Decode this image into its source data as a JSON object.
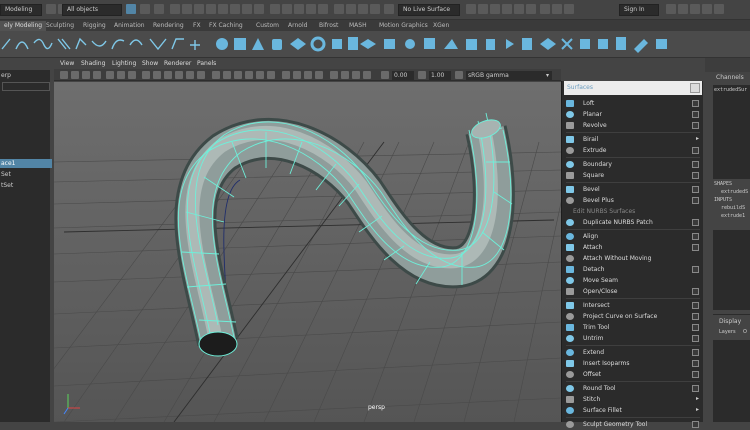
{
  "status_line": {
    "menu_set": "Modeling",
    "selection_mask": "All objects",
    "live_surface": "No Live Surface",
    "sign_in": "Sign In"
  },
  "shelf_tabs": [
    "ely Modeling",
    "Sculpting",
    "Rigging",
    "Animation",
    "Rendering",
    "FX",
    "FX Caching",
    "Custom",
    "Arnold",
    "Bifrost",
    "MASH",
    "Motion Graphics",
    "XGen"
  ],
  "outliner": {
    "items": [
      "erp",
      "ace1",
      "Set",
      "tSet"
    ]
  },
  "viewport": {
    "menus": [
      "View",
      "Shading",
      "Lighting",
      "Show",
      "Renderer",
      "Panels"
    ],
    "exposure": "0.00",
    "gamma": "1.00",
    "color_space": "sRGB gamma",
    "camera": "persp"
  },
  "surfaces_menu": {
    "title": "Surfaces",
    "items": [
      {
        "label": "Loft",
        "box": true
      },
      {
        "label": "Planar",
        "box": true
      },
      {
        "label": "Revolve",
        "box": true
      },
      {
        "sep": true
      },
      {
        "label": "Birail",
        "arrow": true
      },
      {
        "label": "Extrude",
        "box": true
      },
      {
        "sep": true
      },
      {
        "label": "Boundary",
        "box": true
      },
      {
        "label": "Square",
        "box": true
      },
      {
        "sep": true
      },
      {
        "label": "Bevel",
        "box": true
      },
      {
        "label": "Bevel Plus",
        "box": true
      },
      {
        "label": "Edit NURBS Surfaces",
        "section": true
      },
      {
        "label": "Duplicate NURBS Patch",
        "box": true
      },
      {
        "sep": true
      },
      {
        "label": "Align",
        "box": true
      },
      {
        "label": "Attach",
        "box": true
      },
      {
        "label": "Attach Without Moving"
      },
      {
        "label": "Detach",
        "box": true
      },
      {
        "label": "Move Seam"
      },
      {
        "label": "Open/Close",
        "box": true
      },
      {
        "sep": true
      },
      {
        "label": "Intersect",
        "box": true
      },
      {
        "label": "Project Curve on Surface",
        "box": true
      },
      {
        "label": "Trim Tool",
        "box": true
      },
      {
        "label": "Untrim",
        "box": true
      },
      {
        "sep": true
      },
      {
        "label": "Extend",
        "box": true
      },
      {
        "label": "Insert Isoparms",
        "box": true
      },
      {
        "label": "Offset",
        "box": true
      },
      {
        "sep": true
      },
      {
        "label": "Round Tool",
        "box": true
      },
      {
        "label": "Stitch",
        "arrow": true
      },
      {
        "label": "Surface Fillet",
        "arrow": true
      },
      {
        "sep": true
      },
      {
        "label": "Sculpt Geometry Tool",
        "box": true
      }
    ]
  },
  "channel_box": {
    "title": "Channels",
    "object": "extrudedSur",
    "shapes_label": "SHAPES",
    "shape_name": "extrudedS",
    "inputs_label": "INPUTS",
    "input1": "rebuildS",
    "input2": "extrude1",
    "display_tab": "Display",
    "layers_tab": "Layers",
    "options_tab": "O"
  },
  "colors": {
    "accent": "#5285a6",
    "mesh": "#8aa39e",
    "wire": "#7ee3d0"
  }
}
